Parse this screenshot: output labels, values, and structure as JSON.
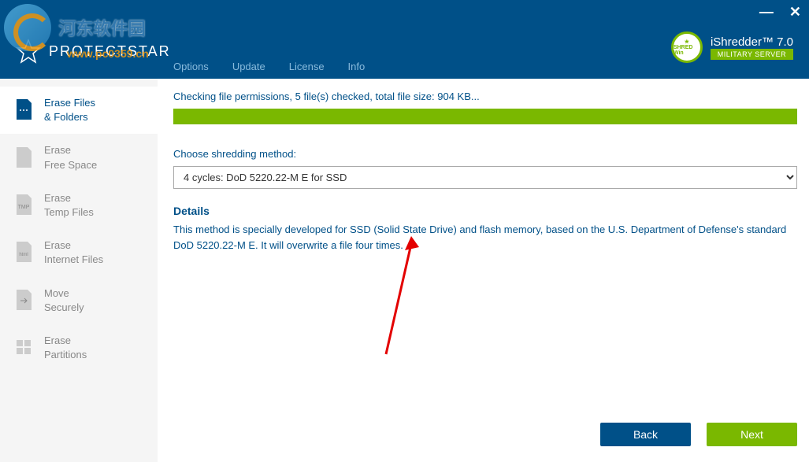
{
  "watermark": {
    "text": "河东软件园",
    "url": "www.pc0359.cn"
  },
  "header": {
    "brand": "PROTECTSTAR",
    "menu": {
      "options": "Options",
      "update": "Update",
      "license": "License",
      "info": "Info"
    },
    "product": {
      "medal": "SHRED Win",
      "name": "iShredder™ 7.0",
      "sub": "MILITARY SERVER"
    }
  },
  "sidebar": {
    "items": [
      {
        "line1": "Erase Files",
        "line2": "& Folders"
      },
      {
        "line1": "Erase",
        "line2": "Free Space"
      },
      {
        "line1": "Erase",
        "line2": "Temp Files"
      },
      {
        "line1": "Erase",
        "line2": "Internet Files"
      },
      {
        "line1": "Move",
        "line2": "Securely"
      },
      {
        "line1": "Erase",
        "line2": "Partitions"
      }
    ]
  },
  "main": {
    "status": "Checking file permissions, 5 file(s) checked, total file size: 904 KB...",
    "method_label": "Choose shredding method:",
    "method_value": "4 cycles: DoD 5220.22-M E for SSD",
    "details_heading": "Details",
    "details_text": "This method is specially developed for SSD (Solid State Drive) and flash memory, based on the U.S. Department of Defense's standard DoD 5220.22-M E. It will overwrite a file four times."
  },
  "buttons": {
    "back": "Back",
    "next": "Next"
  }
}
